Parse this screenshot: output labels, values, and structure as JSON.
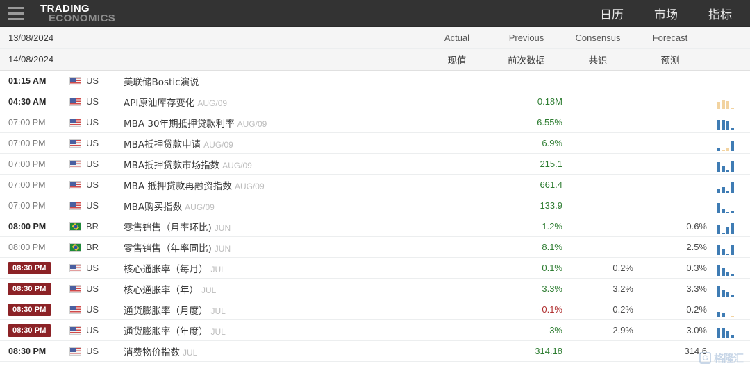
{
  "header": {
    "menu_icon": "hamburger-icon",
    "logo_line1": "TRADING",
    "logo_line2": "ECONOMICS",
    "nav": [
      {
        "label": "日历"
      },
      {
        "label": "市场"
      },
      {
        "label": "指标"
      }
    ]
  },
  "colors": {
    "header_bg": "#333333",
    "badge_red": "#8c2226",
    "positive_green": "#2e7d32",
    "negative_red": "#b03030",
    "spark_blue": "#3f7cb4",
    "spark_tan": "#f2d3a0",
    "header_row_bg": "#f5f5f5"
  },
  "table": {
    "header_rows": [
      {
        "date": "13/08/2024",
        "actual": "Actual",
        "previous": "Previous",
        "consensus": "Consensus",
        "forecast": "Forecast"
      },
      {
        "date": "14/08/2024",
        "actual": "现值",
        "previous": "前次数据",
        "consensus": "共识",
        "forecast": "预测"
      }
    ],
    "rows": [
      {
        "time": "01:15 AM",
        "time_bold": true,
        "time_badge": false,
        "country": "US",
        "flag": "us-flag",
        "event": "美联储Bostic演说",
        "ref": "",
        "actual": "",
        "previous": "",
        "previous_negative": false,
        "consensus": "",
        "forecast": "",
        "spark": []
      },
      {
        "time": "04:30 AM",
        "time_bold": true,
        "time_badge": false,
        "country": "US",
        "flag": "us-flag",
        "event": "API原油库存变化",
        "ref": "AUG/09",
        "actual": "",
        "previous": "0.18M",
        "previous_negative": false,
        "consensus": "",
        "forecast": "",
        "spark": [
          {
            "h": 11,
            "neg": true
          },
          {
            "h": 13,
            "neg": true
          },
          {
            "h": 12,
            "neg": true
          },
          {
            "h": 2,
            "neg": true
          }
        ]
      },
      {
        "time": "07:00 PM",
        "time_bold": false,
        "time_badge": false,
        "country": "US",
        "flag": "us-flag",
        "event": "MBA 30年期抵押贷款利率",
        "ref": "AUG/09",
        "actual": "",
        "previous": "6.55%",
        "previous_negative": false,
        "consensus": "",
        "forecast": "",
        "spark": [
          {
            "h": 15,
            "neg": false
          },
          {
            "h": 15,
            "neg": false
          },
          {
            "h": 14,
            "neg": false
          },
          {
            "h": 3,
            "neg": false
          }
        ]
      },
      {
        "time": "07:00 PM",
        "time_bold": false,
        "time_badge": false,
        "country": "US",
        "flag": "us-flag",
        "event": "MBA抵押贷款申请",
        "ref": "AUG/09",
        "actual": "",
        "previous": "6.9%",
        "previous_negative": false,
        "consensus": "",
        "forecast": "",
        "spark": [
          {
            "h": 5,
            "neg": false
          },
          {
            "h": 2,
            "neg": true
          },
          {
            "h": 4,
            "neg": true
          },
          {
            "h": 14,
            "neg": false
          }
        ]
      },
      {
        "time": "07:00 PM",
        "time_bold": false,
        "time_badge": false,
        "country": "US",
        "flag": "us-flag",
        "event": "MBA抵押贷款市场指数",
        "ref": "AUG/09",
        "actual": "",
        "previous": "215.1",
        "previous_negative": false,
        "consensus": "",
        "forecast": "",
        "spark": [
          {
            "h": 14,
            "neg": false
          },
          {
            "h": 9,
            "neg": false
          },
          {
            "h": 2,
            "neg": false
          },
          {
            "h": 15,
            "neg": false
          }
        ]
      },
      {
        "time": "07:00 PM",
        "time_bold": false,
        "time_badge": false,
        "country": "US",
        "flag": "us-flag",
        "event": "MBA 抵押贷款再融资指数",
        "ref": "AUG/09",
        "actual": "",
        "previous": "661.4",
        "previous_negative": false,
        "consensus": "",
        "forecast": "",
        "spark": [
          {
            "h": 6,
            "neg": false
          },
          {
            "h": 8,
            "neg": false
          },
          {
            "h": 2,
            "neg": false
          },
          {
            "h": 15,
            "neg": false
          }
        ]
      },
      {
        "time": "07:00 PM",
        "time_bold": false,
        "time_badge": false,
        "country": "US",
        "flag": "us-flag",
        "event": "MBA购买指数",
        "ref": "AUG/09",
        "actual": "",
        "previous": "133.9",
        "previous_negative": false,
        "consensus": "",
        "forecast": "",
        "spark": [
          {
            "h": 15,
            "neg": false
          },
          {
            "h": 6,
            "neg": false
          },
          {
            "h": 2,
            "neg": false
          },
          {
            "h": 3,
            "neg": false
          }
        ]
      },
      {
        "time": "08:00 PM",
        "time_bold": true,
        "time_badge": false,
        "country": "BR",
        "flag": "br-flag",
        "event": "零售销售（月率环比)",
        "ref": "JUN",
        "actual": "",
        "previous": "1.2%",
        "previous_negative": false,
        "consensus": "",
        "forecast": "0.6%",
        "spark": [
          {
            "h": 13,
            "neg": false
          },
          {
            "h": 2,
            "neg": false
          },
          {
            "h": 11,
            "neg": false
          },
          {
            "h": 16,
            "neg": false
          }
        ]
      },
      {
        "time": "08:00 PM",
        "time_bold": false,
        "time_badge": false,
        "country": "BR",
        "flag": "br-flag",
        "event": "零售销售（年率同比)",
        "ref": "JUN",
        "actual": "",
        "previous": "8.1%",
        "previous_negative": false,
        "consensus": "",
        "forecast": "2.5%",
        "spark": [
          {
            "h": 15,
            "neg": false
          },
          {
            "h": 8,
            "neg": false
          },
          {
            "h": 2,
            "neg": false
          },
          {
            "h": 15,
            "neg": false
          }
        ]
      },
      {
        "time": "08:30 PM",
        "time_bold": false,
        "time_badge": true,
        "country": "US",
        "flag": "us-flag",
        "event": "核心通胀率（每月）",
        "ref": "JUL",
        "actual": "",
        "previous": "0.1%",
        "previous_negative": false,
        "consensus": "0.2%",
        "forecast": "0.3%",
        "spark": [
          {
            "h": 16,
            "neg": false
          },
          {
            "h": 11,
            "neg": false
          },
          {
            "h": 5,
            "neg": false
          },
          {
            "h": 2,
            "neg": false
          }
        ]
      },
      {
        "time": "08:30 PM",
        "time_bold": false,
        "time_badge": true,
        "country": "US",
        "flag": "us-flag",
        "event": "核心通胀率（年）",
        "ref": "JUL",
        "actual": "",
        "previous": "3.3%",
        "previous_negative": false,
        "consensus": "3.2%",
        "forecast": "3.3%",
        "spark": [
          {
            "h": 16,
            "neg": false
          },
          {
            "h": 10,
            "neg": false
          },
          {
            "h": 6,
            "neg": false
          },
          {
            "h": 3,
            "neg": false
          }
        ]
      },
      {
        "time": "08:30 PM",
        "time_bold": false,
        "time_badge": true,
        "country": "US",
        "flag": "us-flag",
        "event": "通货膨胀率（月度）",
        "ref": "JUL",
        "actual": "",
        "previous": "-0.1%",
        "previous_negative": true,
        "consensus": "0.2%",
        "forecast": "0.2%",
        "spark": [
          {
            "h": 8,
            "neg": false
          },
          {
            "h": 6,
            "neg": false
          },
          {
            "h": 0,
            "neg": false
          },
          {
            "h": 2,
            "neg": true
          }
        ]
      },
      {
        "time": "08:30 PM",
        "time_bold": false,
        "time_badge": true,
        "country": "US",
        "flag": "us-flag",
        "event": "通货膨胀率（年度）",
        "ref": "JUL",
        "actual": "",
        "previous": "3%",
        "previous_negative": false,
        "consensus": "2.9%",
        "forecast": "3.0%",
        "spark": [
          {
            "h": 15,
            "neg": false
          },
          {
            "h": 14,
            "neg": false
          },
          {
            "h": 11,
            "neg": false
          },
          {
            "h": 4,
            "neg": false
          }
        ]
      },
      {
        "time": "08:30 PM",
        "time_bold": true,
        "time_badge": false,
        "country": "US",
        "flag": "us-flag",
        "event": "消费物价指数",
        "ref": "JUL",
        "actual": "",
        "previous": "314.18",
        "previous_negative": false,
        "consensus": "",
        "forecast": "314.6",
        "spark": []
      }
    ]
  },
  "watermark": {
    "logo_letter": "G",
    "text": "格隆汇"
  }
}
